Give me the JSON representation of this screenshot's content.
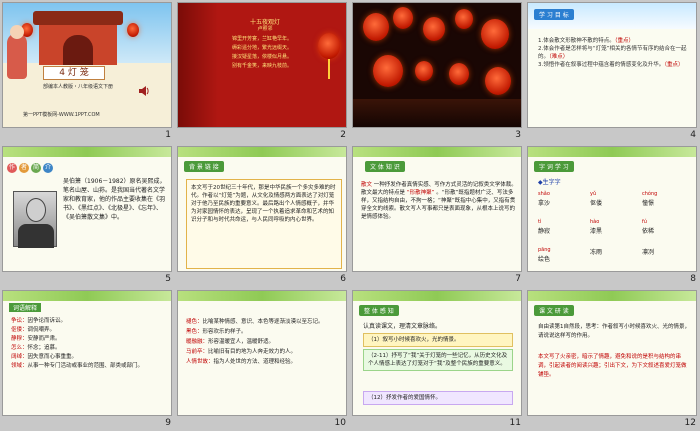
{
  "slides": [
    {
      "number": "1",
      "title": "4 灯 笼",
      "publisher": "部编本人教版・八年级语文下册",
      "footer": "第一PPT模板网-WWW.1PPT.COM"
    },
    {
      "number": "2",
      "poem_title": "十五夜观灯",
      "poem_author": "卢照邻",
      "poem_lines": [
        "锦里开芳宴，兰缸艳早年。",
        "缛彩遥分地，繁光远缀天。",
        "接汉疑星落，依楼似月悬。",
        "别有千金笑，来映九枝前。"
      ]
    },
    {
      "number": "3"
    },
    {
      "number": "4",
      "tag": "学 习 目 标",
      "items": [
        "1.体会散文形散神不散的特点。",
        "（重点）",
        "2.体会作者是怎样将与“灯笼”相关的各情节有序的结合在一起的。",
        "（难点）",
        "3.领悟作者在叙事过程中蕴含着的情感变化及升华。",
        "（重点）"
      ]
    },
    {
      "number": "5",
      "tag_text": [
        "作",
        "者",
        "简",
        "介"
      ],
      "bio": "吴伯箫（1906－1982）原名吴熙成，笔名山屋、山荪。是我国当代著名文学家和教育家，他的作品主要收集在《羽书》、《黑红点》、《北极星》、《忘年》、《吴伯箫散文集》中。"
    },
    {
      "number": "6",
      "tag": "背 景 链 接",
      "text": "本文写于20世纪三十年代，那是中华民族一个多灾多难的时代。作者以“灯笼”为题，从文化及情感两方面表达了对灯笼对于他乃至民族的重要意义。最后路出个人情感概子，并华为对家园情怀的表达，呈现了一个执着追求革命和艺术的知识分子和与时代共命运，与人民同呼吸的内心世界。"
    },
    {
      "number": "7",
      "tag": "文 体 知 识",
      "text_a": "散文",
      "text_b": "一种抒发作者真情实感、写作方式灵活的记叙类文学体裁。散文最大的特点是",
      "highlight": "“形散神聚”",
      "text_c": "。“形散”既指题材广泛、写法多样，又指结构自由，不拘一格；“神聚”既指中心集中，又指有贯穿全文的线索。散文写人写事都只是表面现象，从根本上说写的是情感体验。"
    },
    {
      "number": "8",
      "tag": "字 词 学 习",
      "heading": "◆生字字",
      "words": [
        {
          "py": "shǎo",
          "w": "拿沙"
        },
        {
          "py": "yǔ",
          "w": "伛偻"
        },
        {
          "py": "chóng",
          "w": "憧憬"
        },
        {
          "py": "tì",
          "w": "静寂"
        },
        {
          "py": "",
          "w": "寂静"
        },
        {
          "py": "hào",
          "w": "旗旗"
        },
        {
          "py": "",
          "w": "磅礴"
        },
        {
          "py": "fú",
          "w": "仿拂"
        },
        {
          "py": "pāng",
          "w": "漆黑"
        },
        {
          "py": "",
          "w": "磅礴"
        },
        {
          "py": "",
          "w": "依稀"
        }
      ],
      "words_row1": [
        "拿沙",
        "伛偻",
        "憧憬"
      ],
      "words_row2": [
        "静寂",
        "漆黑",
        "依稀"
      ],
      "words_row3": [
        "绘色",
        "冻雨",
        "凛冽"
      ]
    },
    {
      "number": "9",
      "tag": "词语解释",
      "defs": [
        {
          "term": "争讼：",
          "def": "因争论而诉讼。"
        },
        {
          "term": "伛偻：",
          "def": "调侃嘲弄。"
        },
        {
          "term": "静穆：",
          "def": "安静而严肃。"
        },
        {
          "term": "怎么：",
          "def": "怀念；追慕。"
        },
        {
          "term": "阔绰：",
          "def": "因失意而心事重重。"
        },
        {
          "term": "领域：",
          "def": "从事一种专门活动或事业的范围、部类或部门。"
        }
      ]
    },
    {
      "number": "10",
      "defs": [
        {
          "term": "褪色：",
          "def": "比喻某种情感、意识、本色等逐渐淡漠以至忘记。"
        },
        {
          "term": "黑色：",
          "def": "形容欢乐的样子。"
        },
        {
          "term": "暖融融：",
          "def": "形容温暖宜人，温暖舒适。"
        },
        {
          "term": "马前卒：",
          "def": "比喻旧有目的地为人奔走效力的人。"
        },
        {
          "term": "人情世故：",
          "def": "指为人处世的方法、道理和经验。"
        }
      ]
    },
    {
      "number": "11",
      "tag": "整 体 感 知",
      "intro": "认真读课文，理清文章脉络。",
      "b1": "（1）叙写小时候喜欢火，光的情景。",
      "b2": "（2-11）抒写了“我”关于灯笼的一些记忆，从历史文化及个人情感上表达了灯笼对于“我”及整个民族的重要意义。",
      "b3": "（12）抒发作者的爱国情怀。"
    },
    {
      "number": "12",
      "tag": "课 文 研 读",
      "q": "自由读第1自然段，思考：作者叙写小时候喜欢火、光的情景，请说说这样写的作用。",
      "a": "本文写了火亲密，暗示了情趣，避免和说的是积与结构的串调，引起读者的阅读兴趣；引出下文，为下文叙述喜爱灯笼做铺垫。"
    }
  ]
}
